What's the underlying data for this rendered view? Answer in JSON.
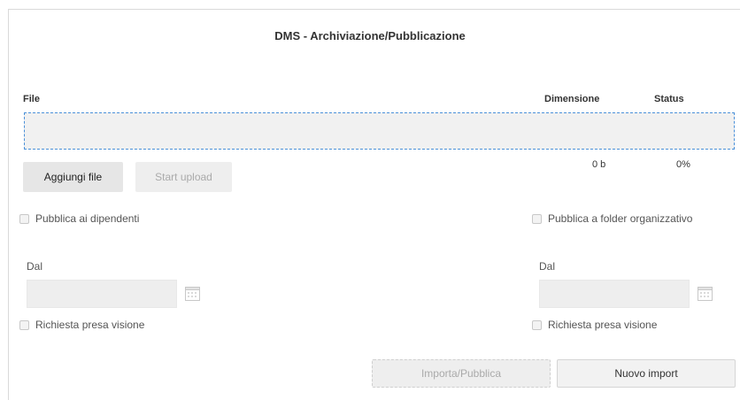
{
  "dialog": {
    "title": "DMS - Archiviazione/Pubblicazione"
  },
  "table": {
    "col_file": "File",
    "col_size": "Dimensione",
    "col_status": "Status",
    "total_size": "0 b",
    "total_status": "0%"
  },
  "buttons": {
    "add_files": "Aggiungi file",
    "start_upload": "Start upload",
    "import_publish": "Importa/Pubblica",
    "new_import": "Nuovo import"
  },
  "left_panel": {
    "publish_label": "Pubblica ai dipendenti",
    "date_label": "Dal",
    "date_value": "",
    "view_request_label": "Richiesta presa visione"
  },
  "right_panel": {
    "publish_label": "Pubblica a folder organizzativo",
    "date_label": "Dal",
    "date_value": "",
    "view_request_label": "Richiesta presa visione"
  },
  "icons": {
    "calendar": "calendar-icon",
    "checkbox": "checkbox-unchecked"
  },
  "colors": {
    "dropzone_border": "#4a90d9",
    "button_bg": "#e6e6e6",
    "disabled_text": "#aaaaaa"
  }
}
